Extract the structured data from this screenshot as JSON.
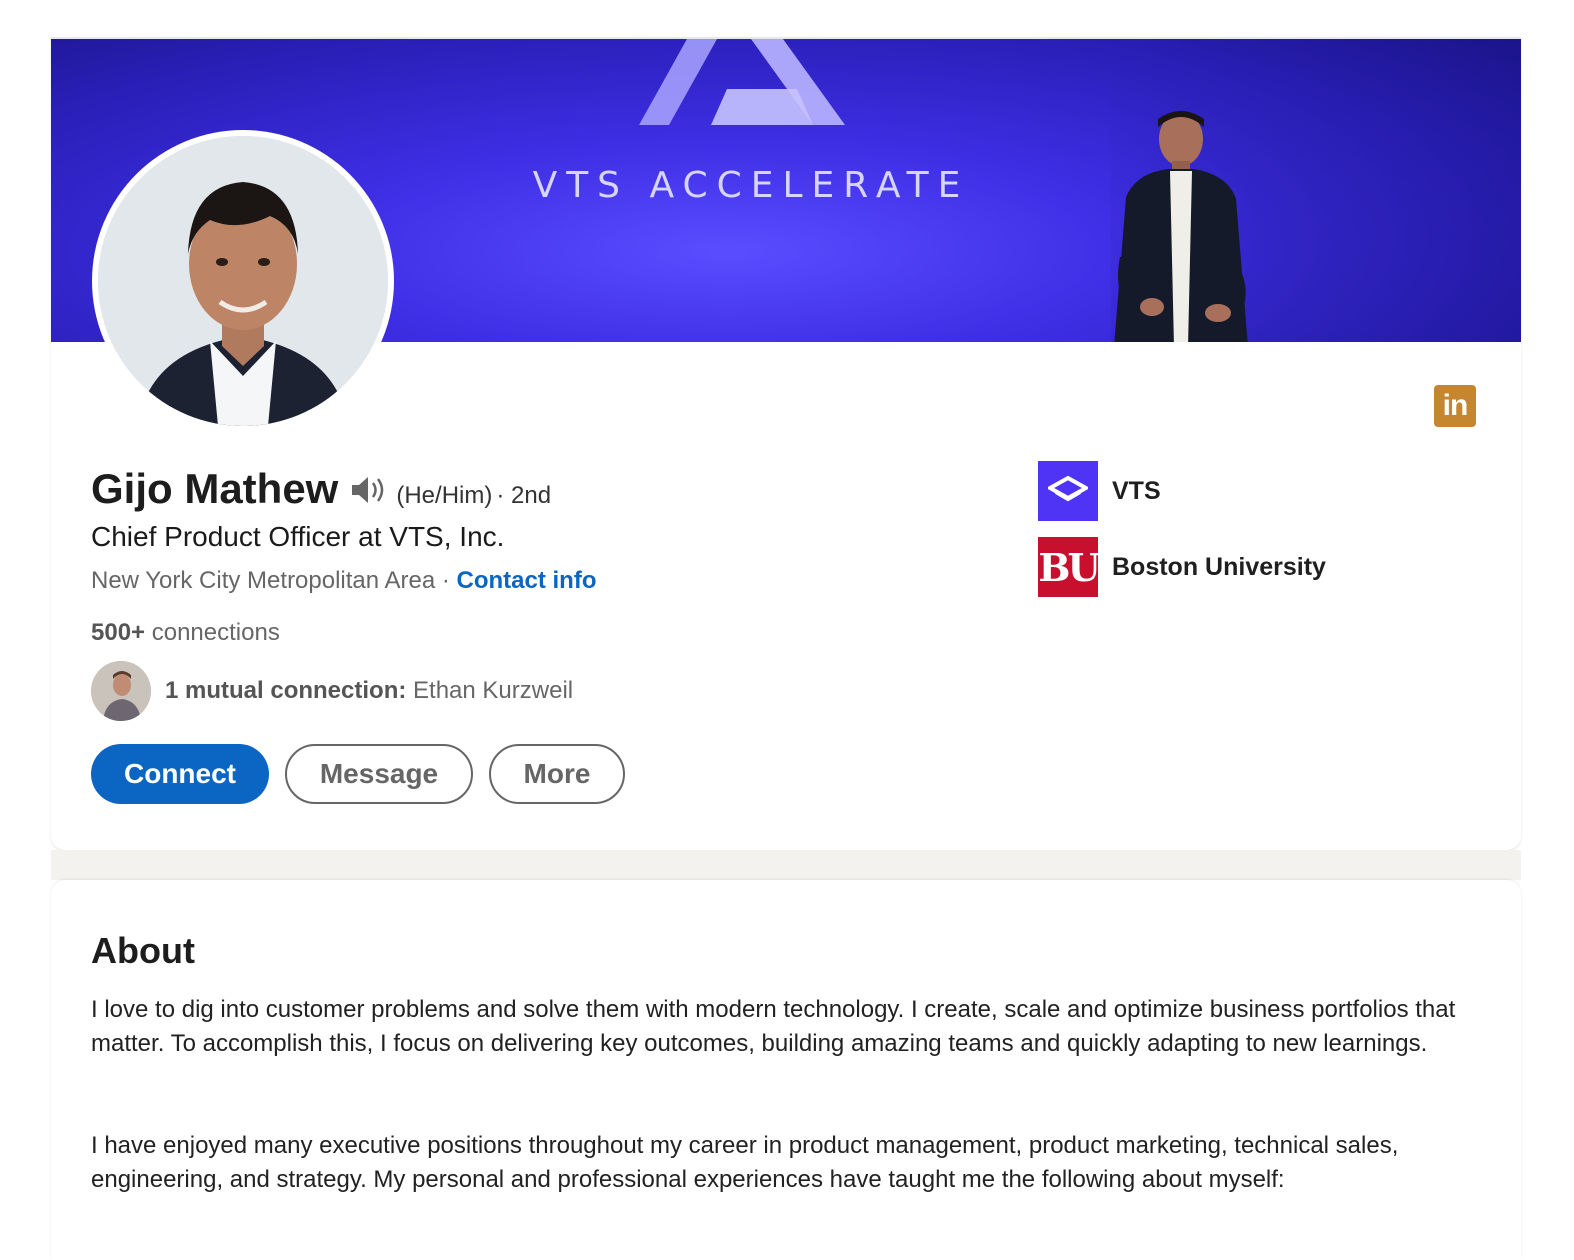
{
  "banner": {
    "title": "VTS ACCELERATE"
  },
  "profile": {
    "name": "Gijo Mathew",
    "pronouns": "(He/Him)",
    "degree": "· 2nd",
    "headline": "Chief Product Officer at VTS, Inc.",
    "location": "New York City Metropolitan Area",
    "separator": " · ",
    "contact_info": "Contact info",
    "connections_count": "500+",
    "connections_label": " connections",
    "mutual_label": "1 mutual connection:",
    "mutual_name": " Ethan Kurzweil"
  },
  "actions": {
    "connect": "Connect",
    "message": "Message",
    "more": "More"
  },
  "badge": {
    "text": "in",
    "color": "#c6862f"
  },
  "organizations": [
    {
      "name": "VTS",
      "logo": "vts-logo",
      "color": "#4f34f5"
    },
    {
      "name": "Boston University",
      "logo_text": "BU",
      "color": "#c8102e"
    }
  ],
  "about": {
    "title": "About",
    "paragraphs": [
      "I love to dig into customer problems and solve them with modern technology. I create, scale and optimize business portfolios that matter. To accomplish this, I focus on delivering key outcomes, building amazing teams and quickly adapting to new learnings.",
      "I have enjoyed many executive positions throughout my career in product management, product marketing, technical sales, engineering, and strategy. My personal and professional experiences have taught me the following about myself:"
    ]
  },
  "colors": {
    "accent": "#0a66c2",
    "banner": "#3f2fe6"
  }
}
